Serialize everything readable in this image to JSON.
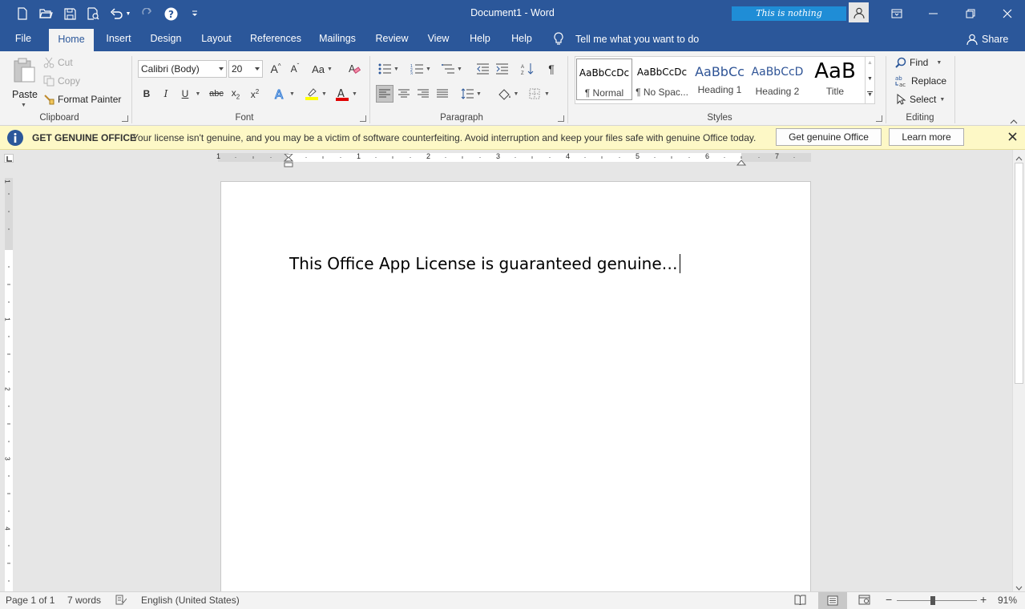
{
  "titlebar": {
    "title": "Document1  -  Word",
    "banner_text": "This is nothing",
    "quick_access": [
      "new-document-icon",
      "open-icon",
      "save-icon",
      "print-preview-icon",
      "undo-icon",
      "redo-icon",
      "help-icon",
      "customize-qat-icon"
    ]
  },
  "tabs": [
    {
      "label": "File",
      "active": false
    },
    {
      "label": "Home",
      "active": true
    },
    {
      "label": "Insert",
      "active": false
    },
    {
      "label": "Design",
      "active": false
    },
    {
      "label": "Layout",
      "active": false
    },
    {
      "label": "References",
      "active": false
    },
    {
      "label": "Mailings",
      "active": false
    },
    {
      "label": "Review",
      "active": false
    },
    {
      "label": "View",
      "active": false
    },
    {
      "label": "Help",
      "active": false
    },
    {
      "label": "Help",
      "active": false
    }
  ],
  "tell_me": "Tell me what you want to do",
  "share": "Share",
  "clipboard": {
    "paste": "Paste",
    "cut": "Cut",
    "copy": "Copy",
    "format_painter": "Format Painter",
    "label": "Clipboard"
  },
  "font": {
    "name": "Calibri (Body)",
    "size": "20",
    "label": "Font",
    "bold": "B",
    "italic": "I",
    "underline": "U",
    "strike": "abc",
    "grow": "A",
    "shrink": "A",
    "change_case": "Aa",
    "font_color_letter": "A",
    "highlight_color": "#ffff00",
    "font_color": "#e00000"
  },
  "paragraph": {
    "label": "Paragraph",
    "show_marks": "¶"
  },
  "styles": {
    "label": "Styles",
    "items": [
      {
        "preview": "AaBbCcDc",
        "name": "¶ Normal"
      },
      {
        "preview": "AaBbCcDc",
        "name": "¶ No Spac..."
      },
      {
        "preview": "AaBbCc",
        "name": "Heading 1"
      },
      {
        "preview": "AaBbCcD",
        "name": "Heading 2"
      },
      {
        "preview": "AaB",
        "name": "Title"
      }
    ]
  },
  "editing": {
    "label": "Editing",
    "find": "Find",
    "replace": "Replace",
    "select": "Select"
  },
  "infobar": {
    "title": "GET GENUINE OFFICE",
    "message": "Your license isn't genuine, and you may be a victim of software counterfeiting. Avoid interruption and keep your files safe with genuine Office today.",
    "button_primary": "Get genuine Office",
    "button_secondary": "Learn more"
  },
  "ruler": {
    "numbers": [
      "1",
      "1",
      "2",
      "3",
      "4",
      "5",
      "6",
      "7"
    ]
  },
  "vruler": {
    "numbers": [
      "1",
      "1",
      "2",
      "3",
      "4"
    ]
  },
  "document": {
    "text": "This Office App License is guaranteed genuine…"
  },
  "statusbar": {
    "page": "Page 1 of 1",
    "words": "7 words",
    "language": "English (United States)",
    "zoom": "91%",
    "zoom_minus": "−",
    "zoom_plus": "+"
  },
  "colors": {
    "brand": "#2b579a",
    "infobar": "#fdf8c6"
  }
}
